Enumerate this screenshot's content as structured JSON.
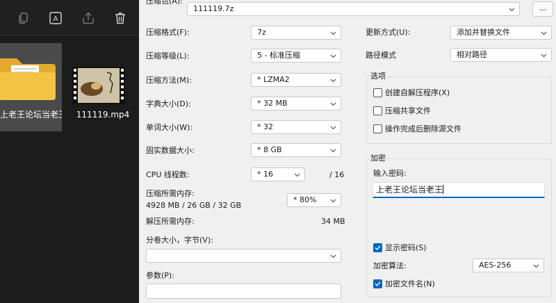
{
  "explorer": {
    "toolbar_icons": [
      "copy-icon",
      "translate-icon",
      "share-icon",
      "delete-icon"
    ],
    "folder": {
      "name": "上老王论坛当老王",
      "icon": "folder-icon",
      "color": "#f3c444"
    },
    "video": {
      "name": "111119.mp4",
      "icon": "video-thumbnail-icon"
    }
  },
  "archive": {
    "label": "压缩包(A):",
    "path": "111119.7z",
    "browse_label": "..."
  },
  "settings": {
    "format_label": "压缩格式(F):",
    "format_value": "7z",
    "level_label": "压缩等级(L):",
    "level_value": "5 - 标准压缩",
    "method_label": "压缩方法(M):",
    "method_value": "* LZMA2",
    "dict_label": "字典大小(D):",
    "dict_value": "* 32 MB",
    "word_label": "单词大小(W):",
    "word_value": "* 32",
    "solid_label": "固实数据大小:",
    "solid_value": "* 8 GB",
    "threads_label": "CPU 线程数:",
    "threads_value": "* 16",
    "threads_total": "/ 16",
    "mem_compress_label": "压缩所需内存:",
    "mem_compress_value": "4928 MB / 26 GB / 32 GB",
    "mem_percent": "* 80%",
    "mem_decompress_label": "解压所需内存:",
    "mem_decompress_value": "34 MB",
    "volume_label": "分卷大小，字节(V):",
    "volume_value": "",
    "params_label": "参数(P):",
    "params_value": ""
  },
  "update": {
    "mode_label": "更新方式(U):",
    "mode_value": "添加并替换文件",
    "path_label": "路径模式",
    "path_value": "相对路径"
  },
  "options": {
    "title": "选项",
    "items": [
      {
        "label": "创建自解压程序(X)",
        "checked": false
      },
      {
        "label": "压缩共享文件",
        "checked": false
      },
      {
        "label": "操作完成后删除源文件",
        "checked": false
      }
    ]
  },
  "encryption": {
    "title": "加密",
    "password_label": "输入密码:",
    "password_value": "上老王论坛当老王",
    "show_password_label": "显示密码(S)",
    "show_password_checked": true,
    "method_label": "加密算法:",
    "method_value": "AES-256",
    "encrypt_names_label": "加密文件名(N)",
    "encrypt_names_checked": true
  },
  "colors": {
    "accent": "#0067c0",
    "explorer_bg": "#1c1c1c",
    "folder": "#f3c444"
  }
}
